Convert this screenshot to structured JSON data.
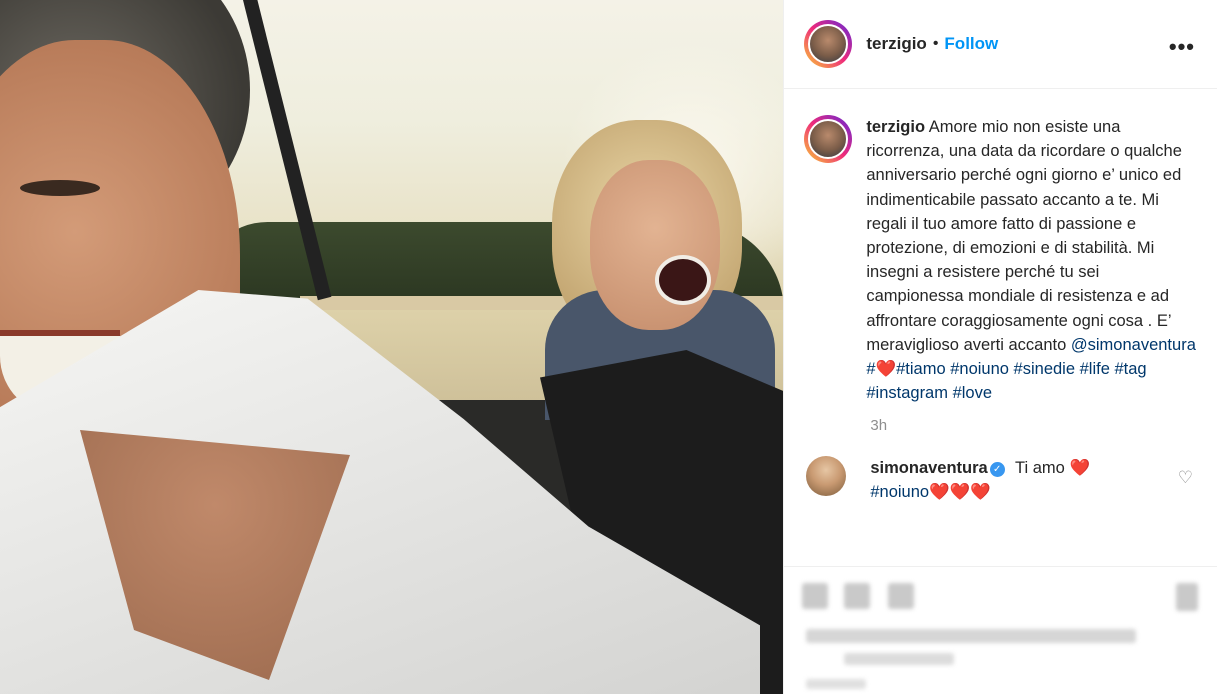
{
  "post": {
    "username": "terzigio",
    "separator": "•",
    "follow_label": "Follow",
    "more_label": "•••"
  },
  "caption": {
    "username": "terzigio",
    "text": "Amore mio non esiste una ricorrenza, una data da ricordare o qualche anniversario perché ogni giorno e’ unico ed indimenticabile passato accanto a te. Mi regali il tuo amore fatto di passione e protezione, di emozioni e di stabilità. Mi insegni a resistere perché tu sei campionessa mondiale di resistenza e ad affrontare coraggiosamente ogni cosa . E’ meraviglioso averti accanto",
    "mention": "@simonaventura",
    "tag_hash": "#",
    "heart": "❤️",
    "tags": [
      "#tiamo",
      "#noiuno",
      "#sinedie",
      "#life",
      "#tag",
      "#instagram",
      "#love"
    ],
    "timestamp": "3h"
  },
  "comment": {
    "username": "simonaventura",
    "verified_icon": "verified-badge-icon",
    "text": "Ti amo",
    "heart": "❤️",
    "tag": "#noiuno",
    "hearts": "❤️❤️❤️",
    "like_icon": "heart-outline-icon",
    "like_glyph": "♡"
  },
  "photo": {
    "description_icon": "post-photo"
  },
  "colors": {
    "link": "#0095f6",
    "hashtag": "#00376b",
    "muted": "#8e8e8e",
    "heart": "#ed1c24"
  }
}
